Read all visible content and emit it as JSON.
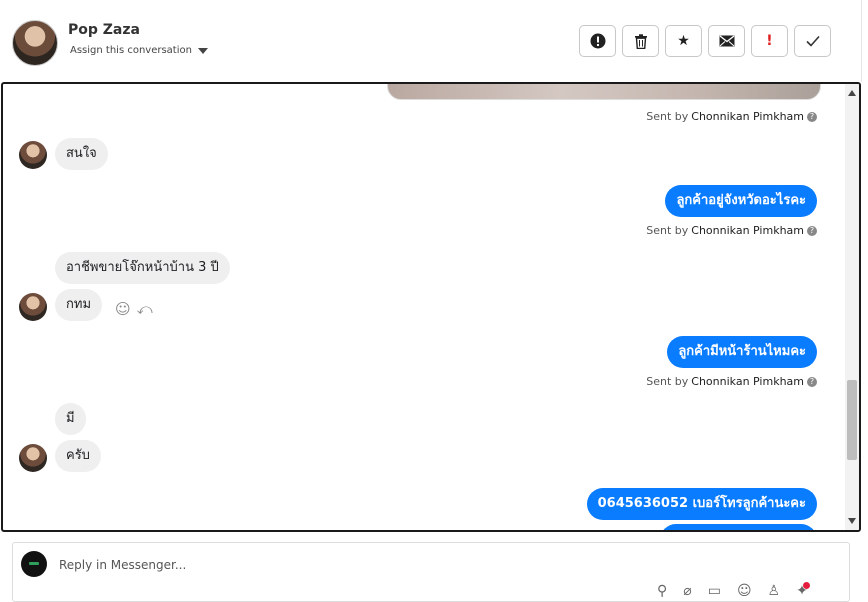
{
  "contact": {
    "name": "Pop Zaza",
    "assign_label": "Assign this conversation"
  },
  "actions": [
    {
      "name": "alert-circle-icon",
      "glyph": "⬤"
    },
    {
      "name": "trash-icon",
      "glyph": "🗑"
    },
    {
      "name": "star-icon",
      "glyph": "★"
    },
    {
      "name": "mail-icon",
      "glyph": "✉"
    },
    {
      "name": "important-icon",
      "glyph": "!"
    },
    {
      "name": "check-icon",
      "glyph": "✓"
    }
  ],
  "sent_by": {
    "prefix": "Sent by",
    "agent": "Chonnikan Pimkham"
  },
  "messages": {
    "m1_in": "สนใจ",
    "m2_out": "ลูกค้าอยู่จังหวัดอะไรคะ",
    "m3_in": "อาชีพขายโจ๊กหน้าบ้าน 3 ปี",
    "m4_in": "กทม",
    "m5_out": "ลูกค้ามีหน้าร้านไหมคะ",
    "m6_in": "มี",
    "m7_in": "ครับ",
    "m8_out": "0645636052 เบอร์โทรลูกค้านะคะ"
  },
  "composer": {
    "placeholder": "Reply in Messenger..."
  },
  "colors": {
    "outgoing_bubble": "#0a7cff",
    "incoming_bubble": "#efefef",
    "notification_dot": "#e41e3f"
  }
}
